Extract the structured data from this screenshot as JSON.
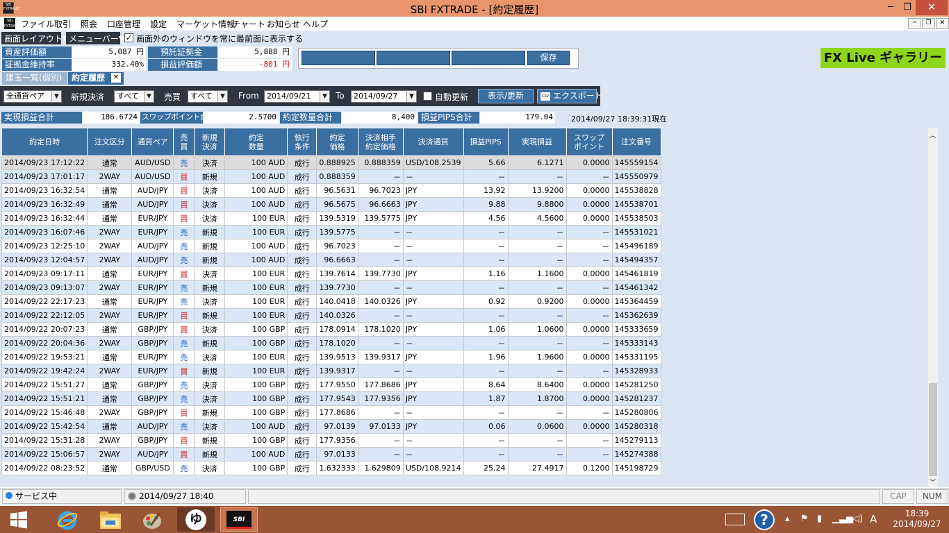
{
  "window": {
    "title": "SBI FXTRADE - [約定履歴]",
    "app_icon_text": "SBI FXTRADE",
    "minimize": "─",
    "maximize": "❐",
    "close": "✕"
  },
  "menubar": {
    "items": [
      "ファイル",
      "取引",
      "照会",
      "口座管理",
      "設定",
      "マーケット情報",
      "チャート",
      "お知らせ",
      "ヘルプ"
    ]
  },
  "toolbar": {
    "layout_label": "画面レイアウト▼",
    "menubar_label": "メニューバー▼",
    "always_on_top_label": "画面外のウィンドウを常に最前面に表示する",
    "always_on_top_checked": true
  },
  "account": {
    "asset_label": "資産評価額",
    "asset_value": "5,087 円",
    "deposit_label": "預託証拠金",
    "deposit_value": "5,888 円",
    "margin_ratio_label": "証拠金維持率",
    "margin_ratio_value": "332.40%",
    "pl_label": "損益評価額",
    "pl_value": "-801 円",
    "save_label": "保存"
  },
  "fxlive": {
    "label": "FX Live ギャラリー"
  },
  "tabs": [
    {
      "label": "建玉一覧(個別)"
    },
    {
      "label": "約定履歴",
      "close": "✕"
    }
  ],
  "filters": {
    "pair": "全通貨ペア",
    "new_settle_label": "新規決済",
    "new_settle": "すべて",
    "side_label": "売買",
    "side": "すべて",
    "from_label": "From",
    "from": "2014/09/21",
    "to_label": "To",
    "to": "2014/09/27",
    "auto_refresh_label": "自動更新",
    "refresh_label": "表示/更新",
    "export_label": "エクスポート",
    "export_icon_text": "CSV"
  },
  "summary": {
    "realized_label": "実現損益合計",
    "realized_value": "186.6724",
    "swap_label": "スワップポイント合計",
    "swap_value": "2.5700",
    "qty_label": "約定数量合計",
    "qty_value": "8,400",
    "pips_label": "損益PIPS合計",
    "pips_value": "179.04",
    "asof": "2014/09/27 18:39:31現在"
  },
  "table": {
    "headers": [
      "約定日時",
      "注文区分",
      "通貨ペア",
      "売\n買",
      "新規\n決済",
      "約定\n数量",
      "執行\n条件",
      "約定\n価格",
      "決済相手\n約定価格",
      "決済通貨",
      "損益PIPS",
      "実現損益",
      "スワップ\nポイント",
      "注文番号"
    ],
    "rows": [
      [
        "2014/09/23 17:12:22",
        "通常",
        "AUD/USD",
        "売",
        "決済",
        "100 AUD",
        "成行",
        "0.888925",
        "0.888359",
        "USD/108.2539",
        "5.66",
        "6.1271",
        "0.0000",
        "145559154"
      ],
      [
        "2014/09/23 17:01:17",
        "2WAY",
        "AUD/USD",
        "買",
        "新規",
        "100 AUD",
        "成行",
        "0.888359",
        "－",
        "－",
        "－",
        "－",
        "－",
        "145550979"
      ],
      [
        "2014/09/23 16:32:54",
        "通常",
        "AUD/JPY",
        "買",
        "決済",
        "100 AUD",
        "成行",
        "96.5631",
        "96.7023",
        "JPY",
        "13.92",
        "13.9200",
        "0.0000",
        "145538828"
      ],
      [
        "2014/09/23 16:32:49",
        "通常",
        "AUD/JPY",
        "買",
        "決済",
        "100 AUD",
        "成行",
        "96.5675",
        "96.6663",
        "JPY",
        "9.88",
        "9.8800",
        "0.0000",
        "145538701"
      ],
      [
        "2014/09/23 16:32:44",
        "通常",
        "EUR/JPY",
        "買",
        "決済",
        "100 EUR",
        "成行",
        "139.5319",
        "139.5775",
        "JPY",
        "4.56",
        "4.5600",
        "0.0000",
        "145538503"
      ],
      [
        "2014/09/23 16:07:46",
        "2WAY",
        "EUR/JPY",
        "売",
        "新規",
        "100 EUR",
        "成行",
        "139.5775",
        "－",
        "－",
        "－",
        "－",
        "－",
        "145531021"
      ],
      [
        "2014/09/23 12:25:10",
        "2WAY",
        "AUD/JPY",
        "売",
        "新規",
        "100 AUD",
        "成行",
        "96.7023",
        "－",
        "－",
        "－",
        "－",
        "－",
        "145496189"
      ],
      [
        "2014/09/23 12:04:57",
        "2WAY",
        "AUD/JPY",
        "売",
        "新規",
        "100 AUD",
        "成行",
        "96.6663",
        "－",
        "－",
        "－",
        "－",
        "－",
        "145494357"
      ],
      [
        "2014/09/23 09:17:11",
        "通常",
        "EUR/JPY",
        "買",
        "決済",
        "100 EUR",
        "成行",
        "139.7614",
        "139.7730",
        "JPY",
        "1.16",
        "1.1600",
        "0.0000",
        "145461819"
      ],
      [
        "2014/09/23 09:13:07",
        "2WAY",
        "EUR/JPY",
        "売",
        "新規",
        "100 EUR",
        "成行",
        "139.7730",
        "－",
        "－",
        "－",
        "－",
        "－",
        "145461342"
      ],
      [
        "2014/09/22 22:17:23",
        "通常",
        "EUR/JPY",
        "売",
        "決済",
        "100 EUR",
        "成行",
        "140.0418",
        "140.0326",
        "JPY",
        "0.92",
        "0.9200",
        "0.0000",
        "145364459"
      ],
      [
        "2014/09/22 22:12:05",
        "2WAY",
        "EUR/JPY",
        "買",
        "新規",
        "100 EUR",
        "成行",
        "140.0326",
        "－",
        "－",
        "－",
        "－",
        "－",
        "145362639"
      ],
      [
        "2014/09/22 20:07:23",
        "通常",
        "GBP/JPY",
        "買",
        "決済",
        "100 GBP",
        "成行",
        "178.0914",
        "178.1020",
        "JPY",
        "1.06",
        "1.0600",
        "0.0000",
        "145333659"
      ],
      [
        "2014/09/22 20:04:36",
        "2WAY",
        "GBP/JPY",
        "売",
        "新規",
        "100 GBP",
        "成行",
        "178.1020",
        "－",
        "－",
        "－",
        "－",
        "－",
        "145333143"
      ],
      [
        "2014/09/22 19:53:21",
        "通常",
        "EUR/JPY",
        "売",
        "決済",
        "100 EUR",
        "成行",
        "139.9513",
        "139.9317",
        "JPY",
        "1.96",
        "1.9600",
        "0.0000",
        "145331195"
      ],
      [
        "2014/09/22 19:42:24",
        "2WAY",
        "EUR/JPY",
        "買",
        "新規",
        "100 EUR",
        "成行",
        "139.9317",
        "－",
        "－",
        "－",
        "－",
        "－",
        "145328933"
      ],
      [
        "2014/09/22 15:51:27",
        "通常",
        "GBP/JPY",
        "売",
        "決済",
        "100 GBP",
        "成行",
        "177.9550",
        "177.8686",
        "JPY",
        "8.64",
        "8.6400",
        "0.0000",
        "145281250"
      ],
      [
        "2014/09/22 15:51:21",
        "通常",
        "GBP/JPY",
        "売",
        "決済",
        "100 GBP",
        "成行",
        "177.9543",
        "177.9356",
        "JPY",
        "1.87",
        "1.8700",
        "0.0000",
        "145281237"
      ],
      [
        "2014/09/22 15:46:48",
        "2WAY",
        "GBP/JPY",
        "買",
        "新規",
        "100 GBP",
        "成行",
        "177.8686",
        "－",
        "－",
        "－",
        "－",
        "－",
        "145280806"
      ],
      [
        "2014/09/22 15:42:54",
        "通常",
        "AUD/JPY",
        "売",
        "決済",
        "100 AUD",
        "成行",
        "97.0139",
        "97.0133",
        "JPY",
        "0.06",
        "0.0600",
        "0.0000",
        "145280318"
      ],
      [
        "2014/09/22 15:31:28",
        "2WAY",
        "GBP/JPY",
        "買",
        "新規",
        "100 GBP",
        "成行",
        "177.9356",
        "－",
        "－",
        "－",
        "－",
        "－",
        "145279113"
      ],
      [
        "2014/09/22 15:06:57",
        "2WAY",
        "AUD/JPY",
        "買",
        "新規",
        "100 AUD",
        "成行",
        "97.0133",
        "－",
        "－",
        "－",
        "－",
        "－",
        "145274388"
      ],
      [
        "2014/09/22 08:23:52",
        "通常",
        "GBP/USD",
        "売",
        "決済",
        "100 GBP",
        "成行",
        "1.632333",
        "1.629809",
        "USD/108.9214",
        "25.24",
        "27.4917",
        "0.1200",
        "145198729"
      ]
    ]
  },
  "statusbar": {
    "service": "サービス中",
    "datetime": "2014/09/27 18:40",
    "cap": "CAP",
    "num": "NUM"
  },
  "taskbar": {
    "time": "18:39",
    "date": "2014/09/27",
    "ime": "A",
    "app_label": "SBI"
  },
  "colors": {
    "title": "#e8956c",
    "header": "#3b6fa1",
    "row_alt": "#d9e7f7",
    "buy": "#d2181a",
    "sell": "#1e57c9",
    "taskbar": "#9a5436",
    "fxlive": "#8dd61b"
  }
}
